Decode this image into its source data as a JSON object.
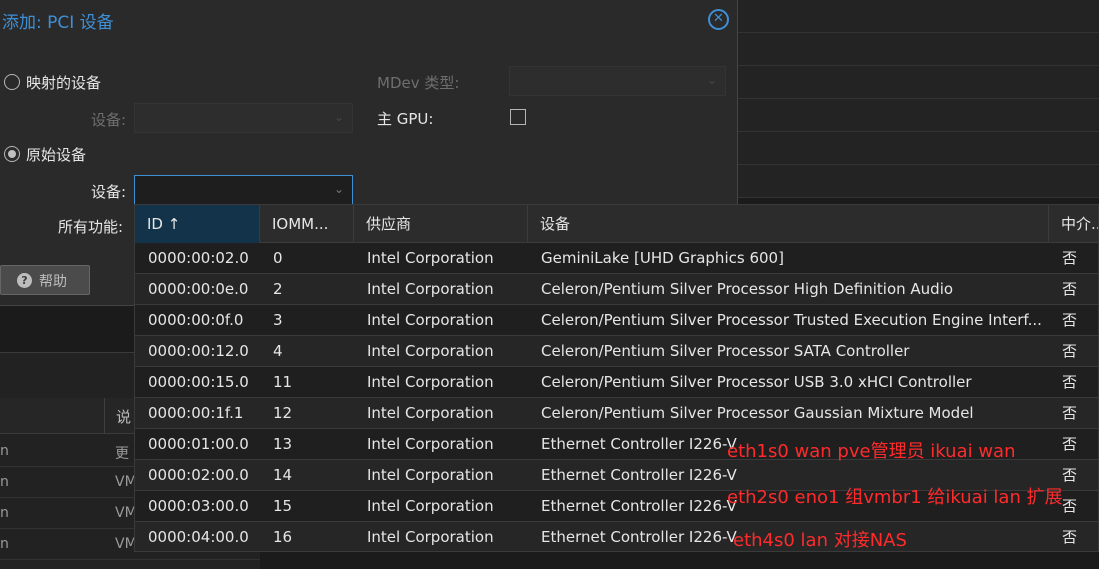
{
  "dialog": {
    "title": "添加: PCI 设备",
    "mapped_device_label": "映射的设备",
    "mapped_device_field_label": "设备:",
    "raw_device_label": "原始设备",
    "raw_device_field_label": "设备:",
    "all_functions_label": "所有功能:",
    "mdev_type_label": "MDev 类型:",
    "primary_gpu_label": "主 GPU:",
    "help_label": "帮助",
    "selected_mode": "raw"
  },
  "grid": {
    "columns": [
      "ID",
      "IOMM...",
      "供应商",
      "设备",
      "中介..."
    ],
    "sort_indicator": "↑",
    "rows": [
      {
        "id": "0000:00:02.0",
        "iommu": "0",
        "vendor": "Intel Corporation",
        "device": "GeminiLake [UHD Graphics 600]",
        "mdev": "否"
      },
      {
        "id": "0000:00:0e.0",
        "iommu": "2",
        "vendor": "Intel Corporation",
        "device": "Celeron/Pentium Silver Processor High Definition Audio",
        "mdev": "否"
      },
      {
        "id": "0000:00:0f.0",
        "iommu": "3",
        "vendor": "Intel Corporation",
        "device": "Celeron/Pentium Silver Processor Trusted Execution Engine Interf...",
        "mdev": "否"
      },
      {
        "id": "0000:00:12.0",
        "iommu": "4",
        "vendor": "Intel Corporation",
        "device": "Celeron/Pentium Silver Processor SATA Controller",
        "mdev": "否"
      },
      {
        "id": "0000:00:15.0",
        "iommu": "11",
        "vendor": "Intel Corporation",
        "device": "Celeron/Pentium Silver Processor USB 3.0 xHCI Controller",
        "mdev": "否"
      },
      {
        "id": "0000:00:1f.1",
        "iommu": "12",
        "vendor": "Intel Corporation",
        "device": "Celeron/Pentium Silver Processor Gaussian Mixture Model",
        "mdev": "否"
      },
      {
        "id": "0000:01:00.0",
        "iommu": "13",
        "vendor": "Intel Corporation",
        "device": "Ethernet Controller I226-V",
        "mdev": "否"
      },
      {
        "id": "0000:02:00.0",
        "iommu": "14",
        "vendor": "Intel Corporation",
        "device": "Ethernet Controller I226-V",
        "mdev": "否"
      },
      {
        "id": "0000:03:00.0",
        "iommu": "15",
        "vendor": "Intel Corporation",
        "device": "Ethernet Controller I226-V",
        "mdev": "否"
      },
      {
        "id": "0000:04:00.0",
        "iommu": "16",
        "vendor": "Intel Corporation",
        "device": "Ethernet Controller I226-V",
        "mdev": "否"
      }
    ]
  },
  "annotations": [
    "eth1s0 wan pve管理员 ikuai wan",
    "eth2s0 eno1 组vmbr1 给ikuai lan 扩展",
    "eth4s0 lan 对接NAS"
  ],
  "background": {
    "table_header": "说",
    "rows": [
      {
        "c1": "n",
        "c2": "更"
      },
      {
        "c1": "n",
        "c2": "VM"
      },
      {
        "c1": "n",
        "c2": "VM"
      },
      {
        "c1": "n",
        "c2": "VM"
      }
    ]
  },
  "colors": {
    "accent": "#3f8fd5",
    "annotation": "#ff2b2b",
    "sorted_header": "#123349"
  }
}
